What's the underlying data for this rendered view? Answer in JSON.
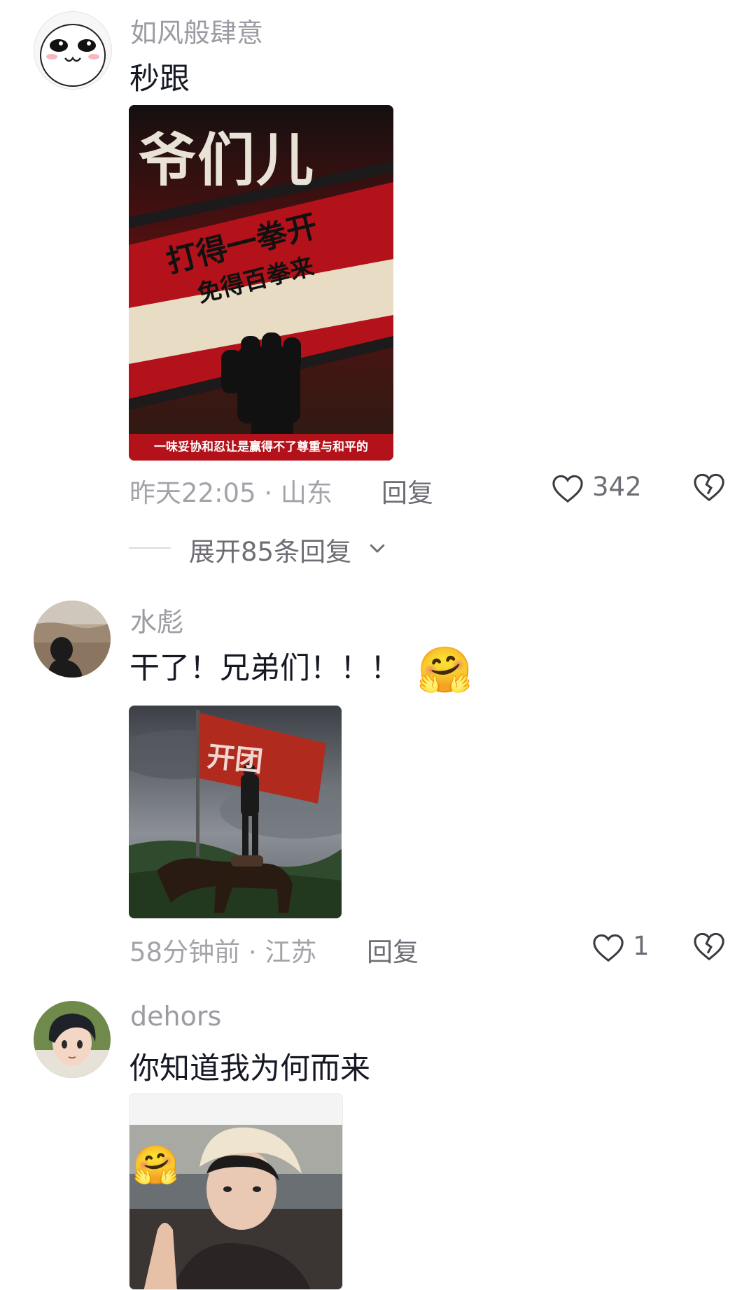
{
  "comments": [
    {
      "username": "如风般肆意",
      "text": "秒跟",
      "image_alt": "爷们儿 poster",
      "poster": {
        "title": "爷们儿",
        "slogan_line1": "打得一拳开",
        "slogan_line2": "免得百拳来",
        "caption": "一味妥协和忍让是赢得不了尊重与和平的"
      },
      "time_location": "昨天22:05 · 山东",
      "reply_label": "回复",
      "like_count": "342",
      "expand_label": "展开85条回复"
    },
    {
      "username": "水彪",
      "text": "干了！兄弟们！！！",
      "emoji": "🤗",
      "flag_text": "开团",
      "time_location": "58分钟前 · 江苏",
      "reply_label": "回复",
      "like_count": "1"
    },
    {
      "username": "dehors",
      "text": "你知道我为何而来",
      "time_location": "",
      "reply_label": ""
    }
  ],
  "colors": {
    "text_primary": "#161823",
    "text_secondary": "#9b9ca3",
    "poster_red": "#b3121a"
  }
}
